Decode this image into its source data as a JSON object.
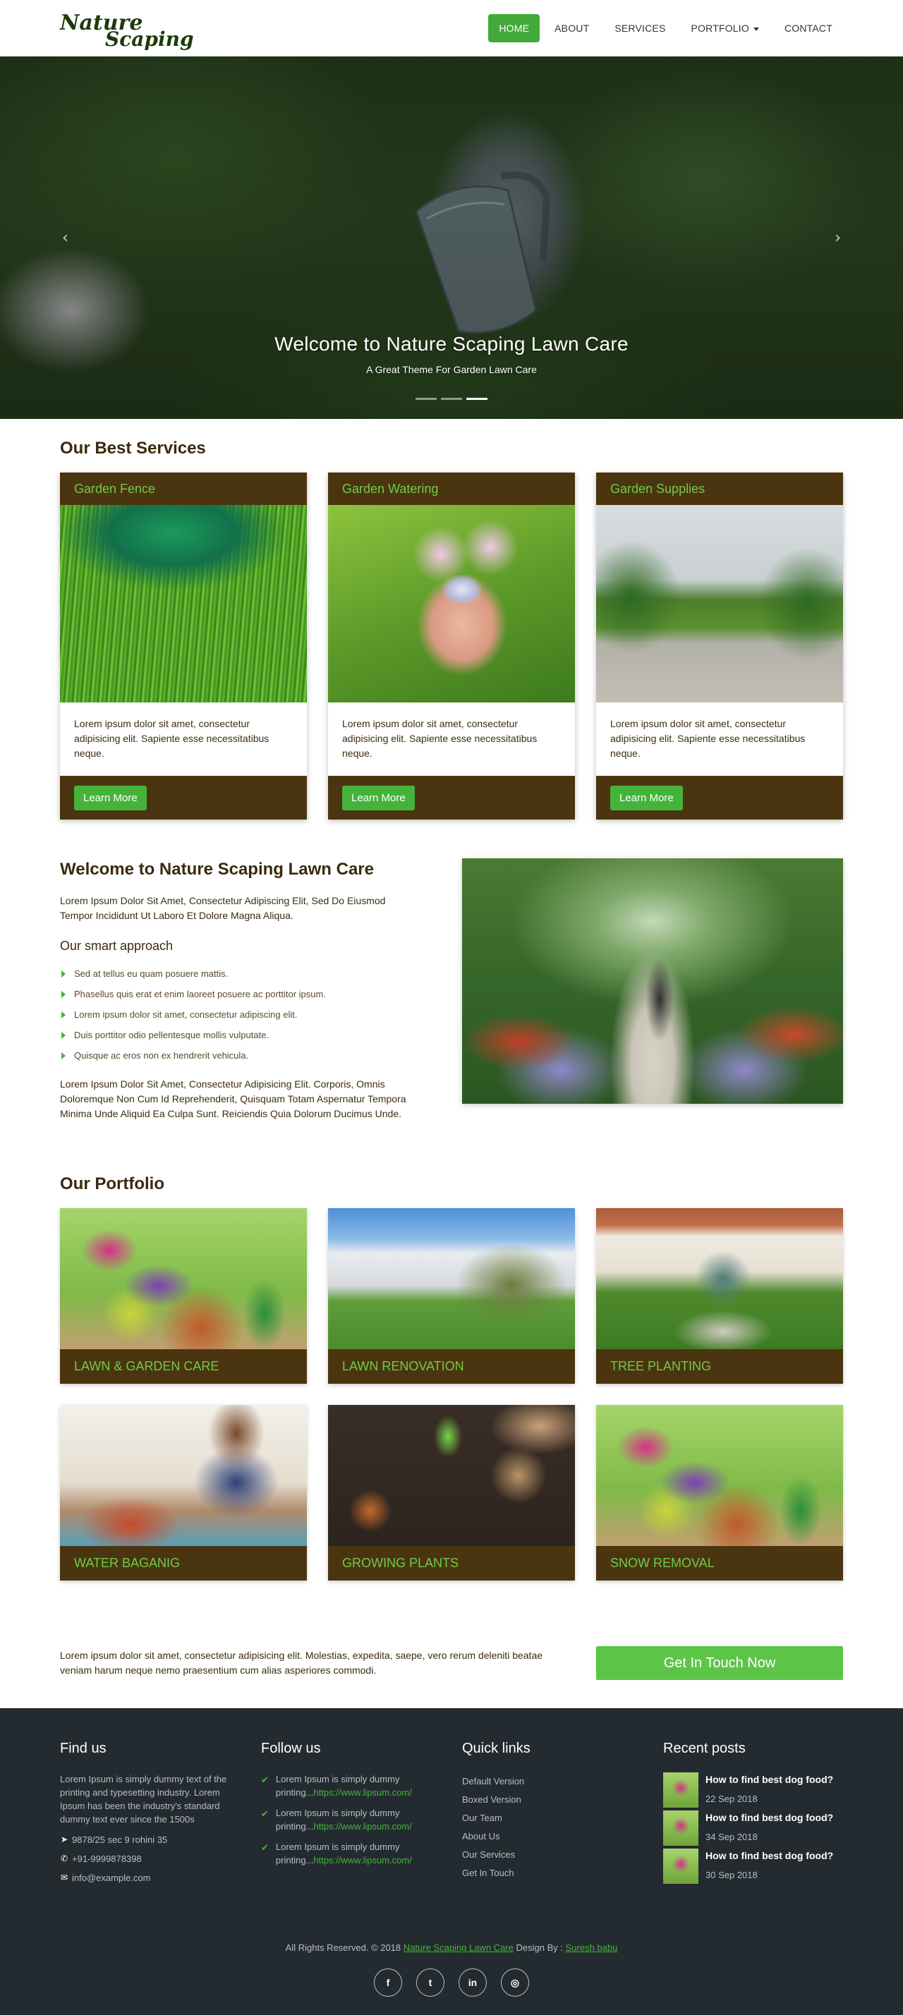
{
  "brand": {
    "line1": "Nature",
    "line2": "Scaping"
  },
  "nav": {
    "items": [
      {
        "label": "HOME"
      },
      {
        "label": "ABOUT"
      },
      {
        "label": "SERVICES"
      },
      {
        "label": "PORTFOLIO"
      },
      {
        "label": "CONTACT"
      }
    ],
    "active": "HOME"
  },
  "hero": {
    "title": "Welcome to Nature Scaping Lawn Care",
    "subtitle": "A Great Theme For Garden Lawn Care",
    "prev_icon": "chevron-left-icon",
    "next_icon": "chevron-right-icon",
    "slides": 3,
    "active_slide": 3
  },
  "services": {
    "heading": "Our Best Services",
    "cards": [
      {
        "title": "Garden Fence",
        "text": "Lorem ipsum dolor sit amet, consectetur adipisicing elit. Sapiente esse necessitatibus neque.",
        "button": "Learn More"
      },
      {
        "title": "Garden Watering",
        "text": "Lorem ipsum dolor sit amet, consectetur adipisicing elit. Sapiente esse necessitatibus neque.",
        "button": "Learn More"
      },
      {
        "title": "Garden Supplies",
        "text": "Lorem ipsum dolor sit amet, consectetur adipisicing elit. Sapiente esse necessitatibus neque.",
        "button": "Learn More"
      }
    ]
  },
  "welcome": {
    "heading": "Welcome to Nature Scaping Lawn Care",
    "lead": "Lorem Ipsum Dolor Sit Amet, Consectetur Adipiscing Elit, Sed Do Eiusmod Tempor Incididunt Ut Laboro Et Dolore Magna Aliqua.",
    "subheading": "Our smart approach",
    "list": [
      "Sed at tellus eu quam posuere mattis.",
      "Phasellus quis erat et enim laoreet posuere ac porttitor ipsum.",
      "Lorem ipsum dolor sit amet, consectetur adipiscing elit.",
      "Duis porttitor odio pellentesque mollis vulputate.",
      "Quisque ac eros non ex hendrerit vehicula."
    ],
    "tail": "Lorem Ipsum Dolor Sit Amet, Consectetur Adipisicing Elit. Corporis, Omnis Doloremque Non Cum Id Reprehenderit, Quisquam Totam Aspernatur Tempora Minima Unde Aliquid Ea Culpa Sunt. Reiciendis Quia Dolorum Ducimus Unde."
  },
  "portfolio": {
    "heading": "Our Portfolio",
    "items": [
      {
        "label": "Lawn & Garden Care"
      },
      {
        "label": "Lawn Renovation"
      },
      {
        "label": "Tree Planting"
      },
      {
        "label": "Water Baganig"
      },
      {
        "label": "Growing Plants"
      },
      {
        "label": "Snow Removal"
      }
    ]
  },
  "cta": {
    "text": "Lorem ipsum dolor sit amet, consectetur adipisicing elit. Molestias, expedita, saepe, vero rerum deleniti beatae veniam harum neque nemo praesentium cum alias asperiores commodi.",
    "button": "Get In Touch Now"
  },
  "footer": {
    "find_us": {
      "heading": "Find us",
      "text": "Lorem Ipsum is simply dummy text of the printing and typesetting industry. Lorem Ipsum has been the industry's standard dummy text ever since the 1500s",
      "address": "9878/25 sec 9 rohini 35",
      "phone": "+91-9999878398",
      "email": "info@example.com"
    },
    "follow_us": {
      "heading": "Follow us",
      "tweets": [
        {
          "text": "Lorem Ipsum is simply dummy printing...",
          "link": "https://www.lipsum.com/"
        },
        {
          "text": "Lorem Ipsum is simply dummy printing...",
          "link": "https://www.lipsum.com/"
        },
        {
          "text": "Lorem Ipsum is simply dummy printing...",
          "link": "https://www.lipsum.com/"
        }
      ]
    },
    "quick_links": {
      "heading": "Quick links",
      "items": [
        "Default Version",
        "Boxed Version",
        "Our Team",
        "About Us",
        "Our Services",
        "Get In Touch"
      ]
    },
    "recent_posts": {
      "heading": "Recent posts",
      "items": [
        {
          "title": "How to find best dog food?",
          "date": "22 Sep 2018"
        },
        {
          "title": "How to find best dog food?",
          "date": "34 Sep 2018"
        },
        {
          "title": "How to find best dog food?",
          "date": "30 Sep 2018"
        }
      ]
    },
    "copyright": {
      "prefix": "All Rights Reserved. © 2018",
      "site": "Nature Scaping Lawn Care",
      "design_by": "Design By :",
      "designer": "Suresh babu"
    },
    "social": [
      {
        "icon": "facebook-icon",
        "glyph": "f"
      },
      {
        "icon": "twitter-icon",
        "glyph": "t"
      },
      {
        "icon": "linkedin-icon",
        "glyph": "in"
      },
      {
        "icon": "instagram-icon",
        "glyph": "◎"
      }
    ]
  },
  "colors": {
    "brown": "#4b3510",
    "green": "#45b33a",
    "light_green": "#6fcb4a",
    "footer_bg": "#242b30"
  }
}
